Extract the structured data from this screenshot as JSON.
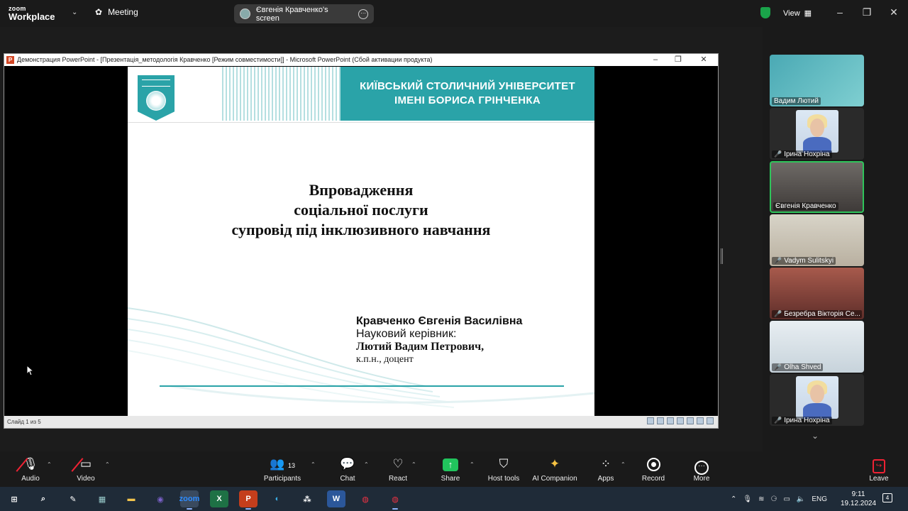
{
  "topbar": {
    "logo_line1": "zoom",
    "logo_line2": "Workplace",
    "meeting_label": "Meeting",
    "screen_label": "Євгенія Кравченко's screen",
    "view_label": "View"
  },
  "ppt": {
    "window_title": "Демонстрация PowerPoint - [Презентація_методологія Кравченко [Режим совместимости]] - Microsoft PowerPoint (Сбой активации продукта)",
    "status_left": "Слайд 1 из 5"
  },
  "slide": {
    "uni_line1": "КИЇВСЬКИЙ СТОЛИЧНИЙ УНІВЕРСИТЕТ",
    "uni_line2": "ІМЕНІ БОРИСА ГРІНЧЕНКА",
    "title_line1": "Впровадження",
    "title_line2": "соціальної послуги",
    "title_line3": "супровід під інклюзивного навчання",
    "author_name": "Кравченко Євгенія Василівна",
    "supervisor_label": "Науковий керівник:",
    "supervisor_name": "Лютий Вадим Петрович,",
    "supervisor_degree": "к.п.н., доцент"
  },
  "participants": [
    {
      "name": "Вадим Лютий",
      "muted": false
    },
    {
      "name": "Ірина Нохріна",
      "muted": true
    },
    {
      "name": "Євгенія Кравченко",
      "muted": false
    },
    {
      "name": "Vadym Sulitskyi",
      "muted": true
    },
    {
      "name": "Безребра Вікторія Се...",
      "muted": true
    },
    {
      "name": "Olha Shved",
      "muted": true
    },
    {
      "name": "Ірина Нохріна",
      "muted": true
    }
  ],
  "toolbar": {
    "audio": "Audio",
    "video": "Video",
    "participants": "Participants",
    "participants_count": "13",
    "chat": "Chat",
    "react": "React",
    "share": "Share",
    "host_tools": "Host tools",
    "ai_companion": "AI Companion",
    "apps": "Apps",
    "record": "Record",
    "more": "More",
    "leave": "Leave"
  },
  "taskbar": {
    "lang": "ENG",
    "time": "9:11",
    "date": "19.12.2024",
    "notifications": "4"
  },
  "colors": {
    "accent_teal": "#2aa3a8",
    "share_green": "#21c45d",
    "active_speaker": "#2ec45a",
    "muted_red": "#e23"
  }
}
